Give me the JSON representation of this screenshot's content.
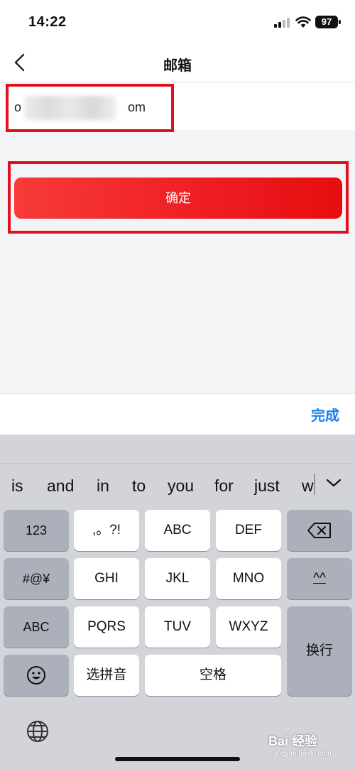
{
  "status": {
    "time": "14:22",
    "battery": "97"
  },
  "nav": {
    "title": "邮箱"
  },
  "email": {
    "value_prefix": "o",
    "value_suffix": "om"
  },
  "confirm_label": "确定",
  "toolbar": {
    "done_label": "完成"
  },
  "suggestions": [
    "is",
    "and",
    "in",
    "to",
    "you",
    "for",
    "just",
    "w"
  ],
  "keys": {
    "k123": "123",
    "punct": ",。?!",
    "abc": "ABC",
    "def": "DEF",
    "symbols": "#@¥",
    "ghi": "GHI",
    "jkl": "JKL",
    "mno": "MNO",
    "emoticon": "^^",
    "abc_mode": "ABC",
    "pqrs": "PQRS",
    "tuv": "TUV",
    "wxyz": "WXYZ",
    "return": "换行",
    "pinyin": "选拼音",
    "space": "空格"
  },
  "watermark": {
    "text": "Bai 经验",
    "sub": "jingyan.baidu.com"
  },
  "accent_color": "#e60d0f",
  "link_color": "#1a7ef0"
}
